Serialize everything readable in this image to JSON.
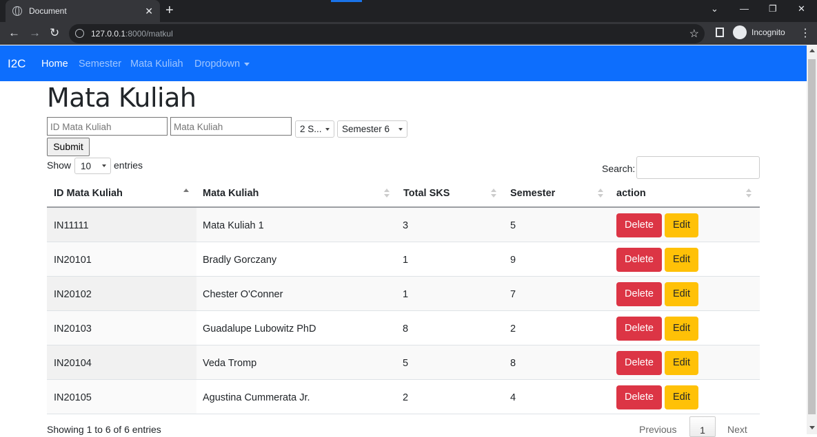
{
  "browser": {
    "tab_title": "Document",
    "tab_close": "✕",
    "new_tab": "+",
    "url_host": "127.0.0.1",
    "url_path": ":8000/matkul",
    "incognito_label": "Incognito",
    "win_min": "—",
    "win_restore": "❐",
    "win_close": "✕",
    "chevron": "⌄"
  },
  "navbar": {
    "brand": "I2C",
    "links": [
      {
        "label": "Home",
        "active": true
      },
      {
        "label": "Semester"
      },
      {
        "label": "Mata Kuliah"
      },
      {
        "label": "Dropdown"
      }
    ]
  },
  "page": {
    "title": "Mata Kuliah",
    "form": {
      "id_placeholder": "ID Mata Kuliah",
      "name_placeholder": "Mata Kuliah",
      "sks_value": "2 S...",
      "semester_value": "Semester 6",
      "submit_label": "Submit"
    },
    "table_controls": {
      "show_label": "Show",
      "length_value": "10",
      "entries_label": "entries",
      "search_label": "Search:"
    },
    "columns": [
      "ID Mata Kuliah",
      "Mata Kuliah",
      "Total SKS",
      "Semester",
      "action"
    ],
    "rows": [
      {
        "id": "IN11111",
        "name": "Mata Kuliah 1",
        "sks": "3",
        "semester": "5"
      },
      {
        "id": "IN20101",
        "name": "Bradly Gorczany",
        "sks": "1",
        "semester": "9"
      },
      {
        "id": "IN20102",
        "name": "Chester O'Conner",
        "sks": "1",
        "semester": "7"
      },
      {
        "id": "IN20103",
        "name": "Guadalupe Lubowitz PhD",
        "sks": "8",
        "semester": "2"
      },
      {
        "id": "IN20104",
        "name": "Veda Tromp",
        "sks": "5",
        "semester": "8"
      },
      {
        "id": "IN20105",
        "name": "Agustina Cummerata Jr.",
        "sks": "2",
        "semester": "4"
      }
    ],
    "delete_label": "Delete",
    "edit_label": "Edit",
    "info": "Showing 1 to 6 of 6 entries",
    "pagination": {
      "previous": "Previous",
      "current": "1",
      "next": "Next"
    }
  },
  "colors": {
    "navbar": "#0d6efd",
    "delete": "#dc3545",
    "edit": "#ffc107"
  }
}
